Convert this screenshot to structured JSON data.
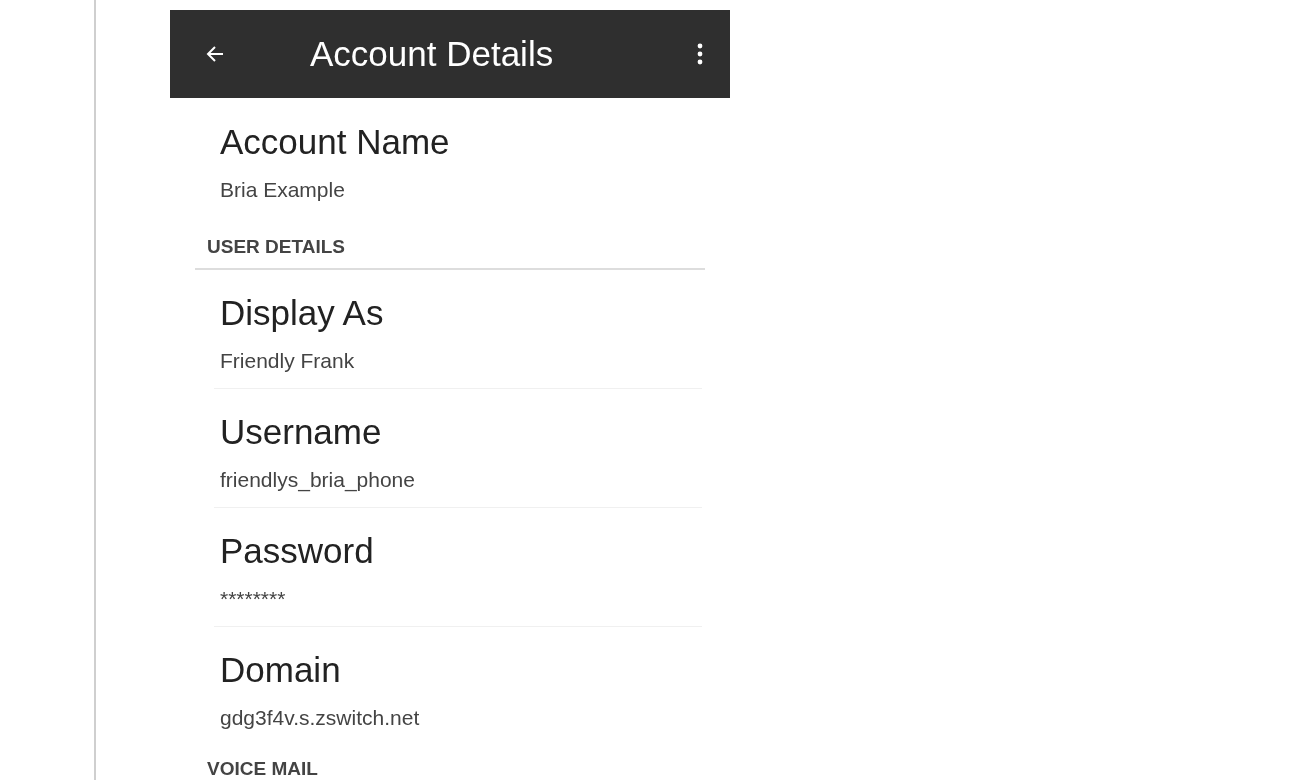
{
  "app_bar": {
    "title": "Account Details"
  },
  "items": [
    {
      "kind": "field",
      "label": "Account Name",
      "value": "Bria Example"
    },
    {
      "kind": "section",
      "label": "USER DETAILS"
    },
    {
      "kind": "field",
      "label": "Display As",
      "value": "Friendly Frank"
    },
    {
      "kind": "field",
      "label": "Username",
      "value": "friendlys_bria_phone"
    },
    {
      "kind": "field",
      "label": "Password",
      "value": "********"
    },
    {
      "kind": "field",
      "label": "Domain",
      "value": "gdg3f4v.s.zswitch.net"
    },
    {
      "kind": "section",
      "label": "VOICE MAIL"
    }
  ]
}
